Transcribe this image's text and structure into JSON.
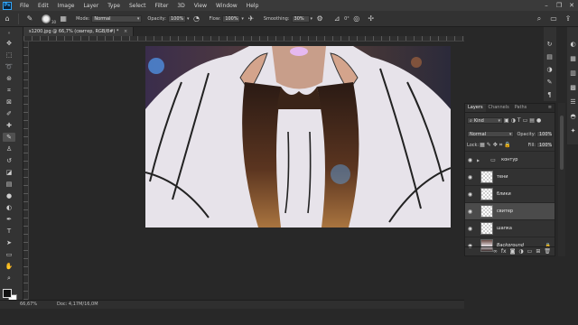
{
  "menubar": {
    "logo": "Ps",
    "items": [
      "File",
      "Edit",
      "Image",
      "Layer",
      "Type",
      "Select",
      "Filter",
      "3D",
      "View",
      "Window",
      "Help"
    ],
    "window_controls": [
      "–",
      "❐",
      "✕"
    ]
  },
  "options_bar": {
    "brush_size": "30",
    "mode_label": "Mode:",
    "mode_value": "Normal",
    "opacity_label": "Opacity:",
    "opacity_value": "100%",
    "flow_label": "Flow:",
    "flow_value": "100%",
    "smoothing_label": "Smoothing:",
    "smoothing_value": "30%",
    "angle_value": "0°"
  },
  "document_tab": {
    "title": "s1200.jpg @ 66,7% (свитер, RGB/8#) *",
    "close": "×"
  },
  "status_bar": {
    "zoom": "66,67%",
    "doc_info": "Doc: 4,17M/16,0M"
  },
  "layers_panel": {
    "tabs": [
      "Layers",
      "Channels",
      "Paths"
    ],
    "active_tab": "Layers",
    "filter_kind": "Kind",
    "blend_mode": "Normal",
    "opacity_label": "Opacity:",
    "opacity_value": "100%",
    "lock_label": "Lock:",
    "fill_label": "Fill:",
    "fill_value": "100%",
    "layers": [
      {
        "name": "контур",
        "type": "group",
        "visible": true,
        "selected": false
      },
      {
        "name": "тени",
        "type": "layer",
        "visible": true,
        "selected": false
      },
      {
        "name": "блики",
        "type": "layer",
        "visible": true,
        "selected": false
      },
      {
        "name": "свитер",
        "type": "layer",
        "visible": true,
        "selected": true
      },
      {
        "name": "шапка",
        "type": "layer",
        "visible": true,
        "selected": false
      },
      {
        "name": "Background",
        "type": "background",
        "visible": true,
        "selected": false,
        "locked": true
      }
    ],
    "bottom_icons": [
      "link-icon",
      "fx-icon",
      "mask-icon",
      "adjustment-icon",
      "folder-icon",
      "new-layer-icon",
      "trash-icon"
    ]
  },
  "colors": {
    "menubar_bg": "#3a3a3a",
    "panel_bg": "#323232",
    "workspace_bg": "#282828",
    "selected_layer_bg": "#4b4b4b",
    "ps_blue": "#31a8ff"
  }
}
